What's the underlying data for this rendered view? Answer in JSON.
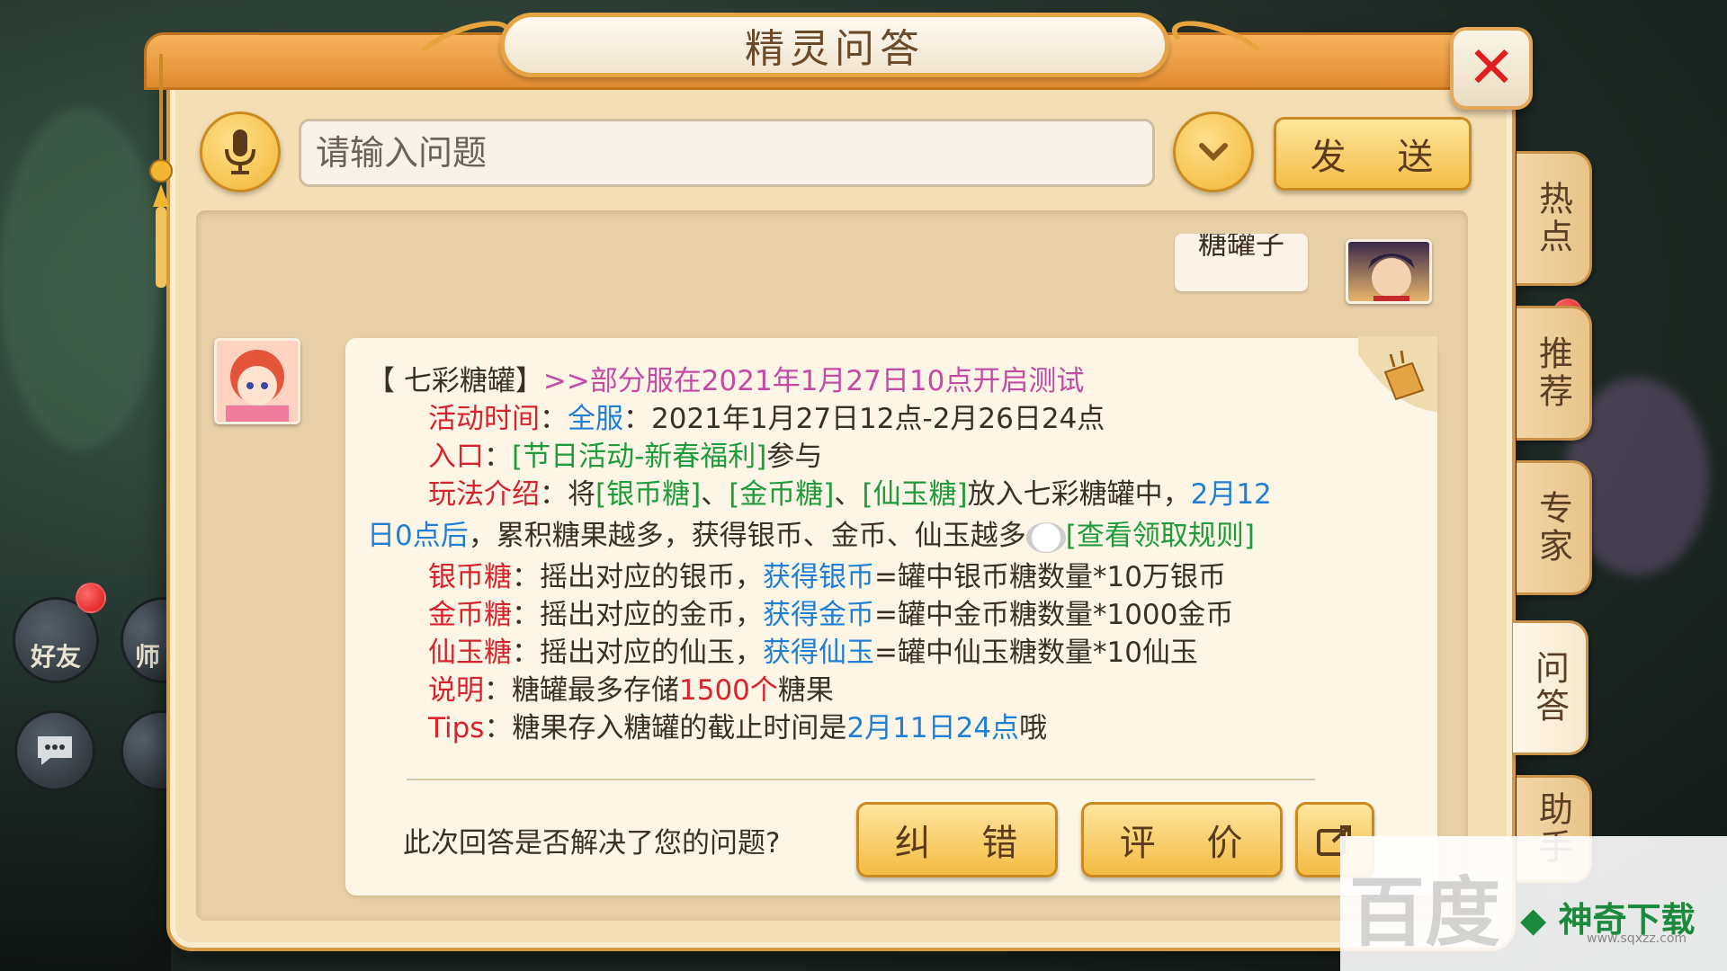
{
  "window": {
    "title": "精灵问答"
  },
  "search": {
    "placeholder": "请输入问题",
    "send_label": "发 送"
  },
  "user_message": "糖罐子",
  "answer": {
    "header_bracket": "【 七彩糖罐】",
    "header_notice": ">>部分服在2021年1月27日10点开启测试",
    "time_label": "活动时间",
    "time_scope": "全服",
    "time_value": "：2021年1月27日12点-2月26日24点",
    "entry_label": "入口",
    "entry_value": "[节日活动-新春福利]",
    "entry_suffix": "参与",
    "play_label": "玩法介绍",
    "play_text1": "：将",
    "item_silver": "[银币糖]",
    "sep": "、",
    "item_gold": "[金币糖]",
    "item_jade": "[仙玉糖]",
    "play_text2": "放入七彩糖罐中，",
    "play_date1": "2月12",
    "play_date2": "日0点后",
    "play_text3": "，累积糖果越多，获得银币、金币、仙玉越多",
    "rules_link": "[查看领取规则]",
    "silver_label": "银币糖",
    "silver_text": "：摇出对应的银币，",
    "silver_gain": "获得银币",
    "silver_formula": "=罐中银币糖数量*10万银币",
    "gold_label": "金币糖",
    "gold_text": "：摇出对应的金币，",
    "gold_gain": "获得金币",
    "gold_formula": "=罐中金币糖数量*1000金币",
    "jade_label": "仙玉糖",
    "jade_text": "：摇出对应的仙玉，",
    "jade_gain": "获得仙玉",
    "jade_formula": "=罐中仙玉糖数量*10仙玉",
    "note_label": "说明",
    "note_text1": "：糖罐最多存储",
    "note_count": "1500个",
    "note_text2": "糖果",
    "tips_label": "Tips",
    "tips_text": "：糖果存入糖罐的截止时间是",
    "tips_date": "2月11日24点",
    "tips_end": "哦"
  },
  "feedback": {
    "question": "此次回答是否解决了您的问题?",
    "correct_label": "纠 错",
    "rate_label": "评 价"
  },
  "side_tabs": [
    {
      "label": "热点"
    },
    {
      "label": "推荐"
    },
    {
      "label": "专家"
    },
    {
      "label": "问答"
    },
    {
      "label": "助手"
    }
  ],
  "left_hud": {
    "friends_label": "好友",
    "master_label": "师"
  },
  "watermark": {
    "baidu": "百度",
    "site": "神奇下载",
    "url": "www.sqxzz.com"
  },
  "colors": {
    "accent": "#f3bb42",
    "close": "#e01e1e",
    "panel": "#f4dfb4",
    "link_blue": "#1f7fd4",
    "green": "#1e9b3a",
    "red": "#d8222c",
    "pink": "#c54aa4"
  }
}
